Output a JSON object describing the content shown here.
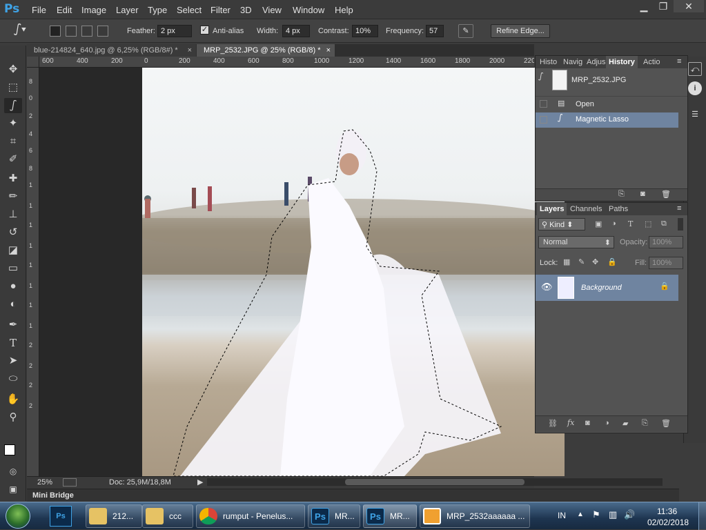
{
  "app": {
    "logo": "Ps"
  },
  "menu": [
    "File",
    "Edit",
    "Image",
    "Layer",
    "Type",
    "Select",
    "Filter",
    "3D",
    "View",
    "Window",
    "Help"
  ],
  "window_controls": {
    "min": "▁",
    "restore": "❐",
    "close": "✕"
  },
  "options": {
    "feather_label": "Feather:",
    "feather_value": "2 px",
    "antialias_label": "Anti-alias",
    "width_label": "Width:",
    "width_value": "4 px",
    "contrast_label": "Contrast:",
    "contrast_value": "10%",
    "frequency_label": "Frequency:",
    "frequency_value": "57",
    "refine_edge": "Refine Edge..."
  },
  "tabs": [
    {
      "label": "blue-214824_640.jpg @ 6,25% (RGB/8#) *",
      "close": "×"
    },
    {
      "label": "MRP_2532.JPG @ 25% (RGB/8) *",
      "close": "×"
    }
  ],
  "ruler_top": [
    "600",
    "400",
    "200",
    "0",
    "200",
    "400",
    "600",
    "800",
    "1000",
    "1200",
    "1400",
    "1600",
    "1800",
    "2000",
    "2200"
  ],
  "ruler_left": [
    "8",
    "0",
    "2",
    "4",
    "6",
    "8",
    "1",
    "1",
    "1",
    "1",
    "1",
    "1",
    "1",
    "1",
    "2",
    "2",
    "2",
    "2"
  ],
  "status": {
    "zoom": "25%",
    "doc": "Doc: 25,9M/18,8M"
  },
  "mini_bridge": "Mini Bridge",
  "history_panel": {
    "tabs": [
      "Histo",
      "Navig",
      "Adjus",
      "History",
      "Actio"
    ],
    "snapshot": "MRP_2532.JPG",
    "states": [
      "Open",
      "Magnetic Lasso"
    ]
  },
  "layers_panel": {
    "tabs": [
      "Layers",
      "Channels",
      "Paths"
    ],
    "kind": "Kind",
    "blend": "Normal",
    "opacity_label": "Opacity:",
    "opacity_value": "100%",
    "lock_label": "Lock:",
    "fill_label": "Fill:",
    "fill_value": "100%",
    "layer_name": "Background"
  },
  "taskbar": {
    "items": [
      {
        "label": "212...",
        "icon": "folder-icon"
      },
      {
        "label": "ccc",
        "icon": "folder-icon"
      },
      {
        "label": "rumput - Penelus...",
        "icon": "chrome-icon"
      },
      {
        "label": "MR...",
        "icon": "photoshop-icon"
      },
      {
        "label": "MR...",
        "icon": "photoshop-icon"
      },
      {
        "label": "MRP_2532aaaaaa ...",
        "icon": "photo-viewer-icon"
      }
    ],
    "lang": "IN",
    "time": "11:36",
    "date": "02/02/2018"
  }
}
